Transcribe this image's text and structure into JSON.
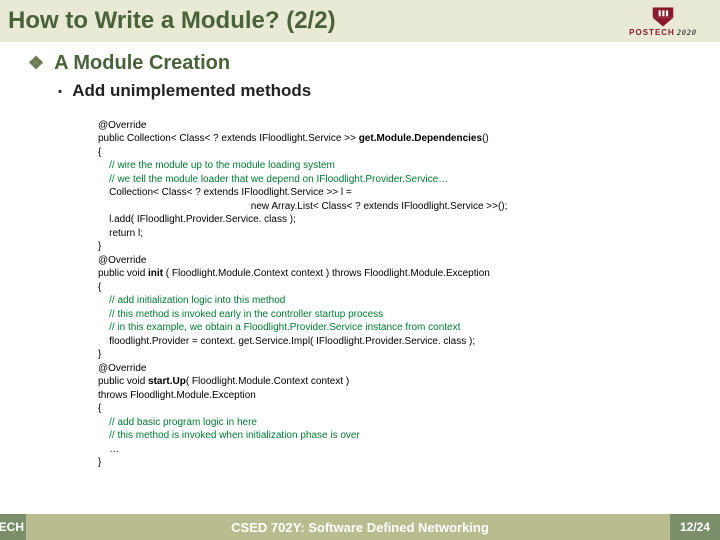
{
  "title": "How to Write a Module? (2/2)",
  "logo": {
    "inst": "POSTECH",
    "year": "2020"
  },
  "bullets": {
    "main": "A Module Creation",
    "sub": "Add unimplemented methods"
  },
  "code": {
    "l01": "@Override",
    "l02a": "public Collection< Class< ? extends IFloodlight.Service >> ",
    "l02b": "get.Module.Dependencies",
    "l02c": "()",
    "l03": "{",
    "l04": "    // wire the module up to the module loading system",
    "l05": "    // we tell the module loader that we depend on IFloodlight.Provider.Service…",
    "l06": "    Collection< Class< ? extends IFloodlight.Service >> l =",
    "l07": "                                                       new Array.List< Class< ? extends IFloodlight.Service >>();",
    "l08": "    l.add( IFloodlight.Provider.Service. class );",
    "l09": "    return l;",
    "l10": "}",
    "l11": "@Override",
    "l12a": "public void ",
    "l12b": "init",
    "l12c": " ( Floodlight.Module.Context context ) throws Floodlight.Module.Exception",
    "l13": "{",
    "l14": "    // add initialization logic into this method",
    "l15": "    // this method is invoked early in the controller startup process",
    "l16": "    // in this example, we obtain a Floodlight.Provider.Service instance from context",
    "l17": "    floodlight.Provider = context. get.Service.Impl( IFloodlight.Provider.Service. class );",
    "l18": "}",
    "l19": "@Override",
    "l20a": "public void ",
    "l20b": "start.Up",
    "l20c": "( Floodlight.Module.Context context )",
    "l21": "throws Floodlight.Module.Exception",
    "l22": "{",
    "l23": "    // add basic program logic in here",
    "l24": "    // this method is invoked when initialization phase is over",
    "l25": "    …",
    "l26": "}"
  },
  "footer": {
    "left": "ECH",
    "center": "CSED 702Y: Software Defined Networking",
    "right": "12/24"
  }
}
